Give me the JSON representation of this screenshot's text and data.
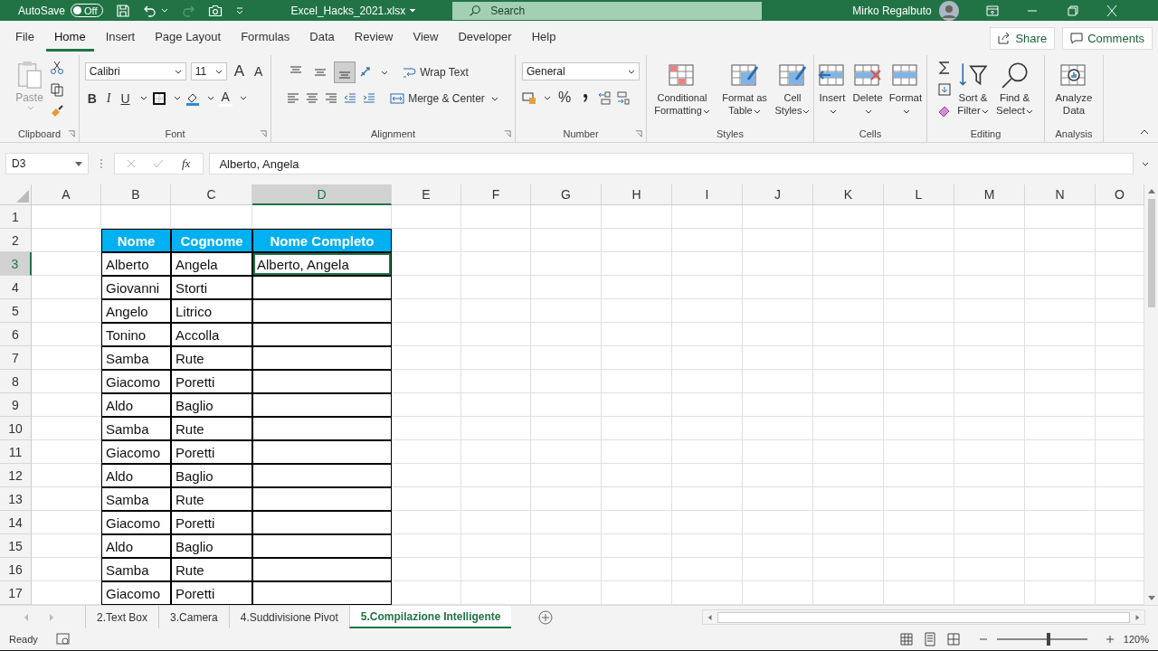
{
  "title_bar": {
    "autosave_label": "AutoSave",
    "autosave_toggle": {
      "label": "Off",
      "on": false
    },
    "file_name": "Excel_Hacks_2021.xlsx",
    "search": {
      "placeholder": "Search"
    },
    "user_name": "Mirko Regalbuto"
  },
  "menu_tabs": [
    {
      "label": "File",
      "selected": false
    },
    {
      "label": "Home",
      "selected": true
    },
    {
      "label": "Insert",
      "selected": false
    },
    {
      "label": "Page Layout",
      "selected": false
    },
    {
      "label": "Formulas",
      "selected": false
    },
    {
      "label": "Data",
      "selected": false
    },
    {
      "label": "Review",
      "selected": false
    },
    {
      "label": "View",
      "selected": false
    },
    {
      "label": "Developer",
      "selected": false
    },
    {
      "label": "Help",
      "selected": false
    }
  ],
  "share": "Share",
  "comments": "Comments",
  "ribbon": {
    "groups": [
      {
        "kind": "clipboard",
        "label": "Clipboard",
        "paste": "Paste"
      },
      {
        "kind": "font",
        "label": "Font",
        "font_name": "Calibri",
        "font_size": "11",
        "grow": "A",
        "shrink": "A",
        "bold": "B",
        "italic": "I",
        "underline": "U",
        "font_letter": "A"
      },
      {
        "kind": "alignment",
        "label": "Alignment",
        "vertical_align": [
          {
            "selected": false
          },
          {
            "selected": false
          },
          {
            "selected": true
          }
        ],
        "wrap": "Wrap Text",
        "merge": "Merge & Center"
      },
      {
        "kind": "number",
        "label": "Number",
        "format": "General",
        "percent": "%"
      },
      {
        "kind": "styles",
        "label": "Styles",
        "buttons": [
          "Conditional Formatting",
          "Format as Table",
          "Cell Styles"
        ]
      },
      {
        "kind": "cells",
        "label": "Cells",
        "buttons": [
          "Insert",
          "Delete",
          "Format"
        ]
      },
      {
        "kind": "editing",
        "label": "Editing",
        "buttons": [
          "Sort & Filter",
          "Find & Select"
        ]
      },
      {
        "kind": "analysis",
        "label": "Analysis",
        "buttons": [
          "Analyze Data"
        ]
      }
    ]
  },
  "formula_bar": {
    "name_box": "D3",
    "fx": "fx",
    "value": "Alberto, Angela"
  },
  "columns": [
    {
      "label": "A",
      "selected": false
    },
    {
      "label": "B",
      "selected": false
    },
    {
      "label": "C",
      "selected": false
    },
    {
      "label": "D",
      "selected": true
    },
    {
      "label": "E",
      "selected": false
    },
    {
      "label": "F",
      "selected": false
    },
    {
      "label": "G",
      "selected": false
    },
    {
      "label": "H",
      "selected": false
    },
    {
      "label": "I",
      "selected": false
    },
    {
      "label": "J",
      "selected": false
    },
    {
      "label": "K",
      "selected": false
    },
    {
      "label": "L",
      "selected": false
    },
    {
      "label": "M",
      "selected": false
    },
    {
      "label": "N",
      "selected": false
    },
    {
      "label": "O",
      "selected": false
    }
  ],
  "row_headers": [
    {
      "label": "1",
      "selected": false
    },
    {
      "label": "2",
      "selected": false
    },
    {
      "label": "3",
      "selected": true
    },
    {
      "label": "4",
      "selected": false
    },
    {
      "label": "5",
      "selected": false
    },
    {
      "label": "6",
      "selected": false
    },
    {
      "label": "7",
      "selected": false
    },
    {
      "label": "8",
      "selected": false
    },
    {
      "label": "9",
      "selected": false
    },
    {
      "label": "10",
      "selected": false
    },
    {
      "label": "11",
      "selected": false
    },
    {
      "label": "12",
      "selected": false
    },
    {
      "label": "13",
      "selected": false
    },
    {
      "label": "14",
      "selected": false
    },
    {
      "label": "15",
      "selected": false
    },
    {
      "label": "16",
      "selected": false
    },
    {
      "label": "17",
      "selected": false
    }
  ],
  "table": {
    "columns": [
      "Nome",
      "Cognome",
      "Nome Completo"
    ],
    "rows": [
      [
        "Alberto",
        "Angela",
        "Alberto, Angela"
      ],
      [
        "Giovanni",
        "Storti"
      ],
      [
        "Angelo",
        "Litrico"
      ],
      [
        "Tonino",
        "Accolla"
      ],
      [
        "Samba",
        "Rute"
      ],
      [
        "Giacomo",
        "Poretti"
      ],
      [
        "Aldo",
        "Baglio"
      ],
      [
        "Samba",
        "Rute"
      ],
      [
        "Giacomo",
        "Poretti"
      ],
      [
        "Aldo",
        "Baglio"
      ],
      [
        "Samba",
        "Rute"
      ],
      [
        "Giacomo",
        "Poretti"
      ],
      [
        "Aldo",
        "Baglio"
      ],
      [
        "Samba",
        "Rute"
      ],
      [
        "Giacomo",
        "Poretti"
      ]
    ]
  },
  "sheet_tabs": [
    {
      "label": "2.Text Box",
      "selected": false
    },
    {
      "label": "3.Camera",
      "selected": false
    },
    {
      "label": "4.Suddivisione Pivot",
      "selected": false
    },
    {
      "label": "5.Compilazione Intelligente",
      "selected": true
    }
  ],
  "status_bar": {
    "ready": "Ready",
    "zoom_slider": {
      "level": 0.55
    },
    "zoom": "120%"
  }
}
